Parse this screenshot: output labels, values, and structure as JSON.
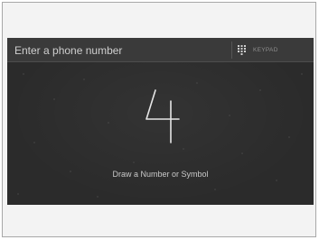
{
  "phone_entry": {
    "placeholder": "Enter a phone number"
  },
  "keypad_button": {
    "label": "KEYPAD",
    "icon": "keypad-grid-icon"
  },
  "handwriting": {
    "recognized_glyph": "4",
    "hint": "Draw a Number or Symbol"
  },
  "colors": {
    "screen_bg": "#2b2b2b",
    "header_bg": "#3a3a3a",
    "text": "#cfcfcf",
    "stroke": "#e6e6e6"
  }
}
